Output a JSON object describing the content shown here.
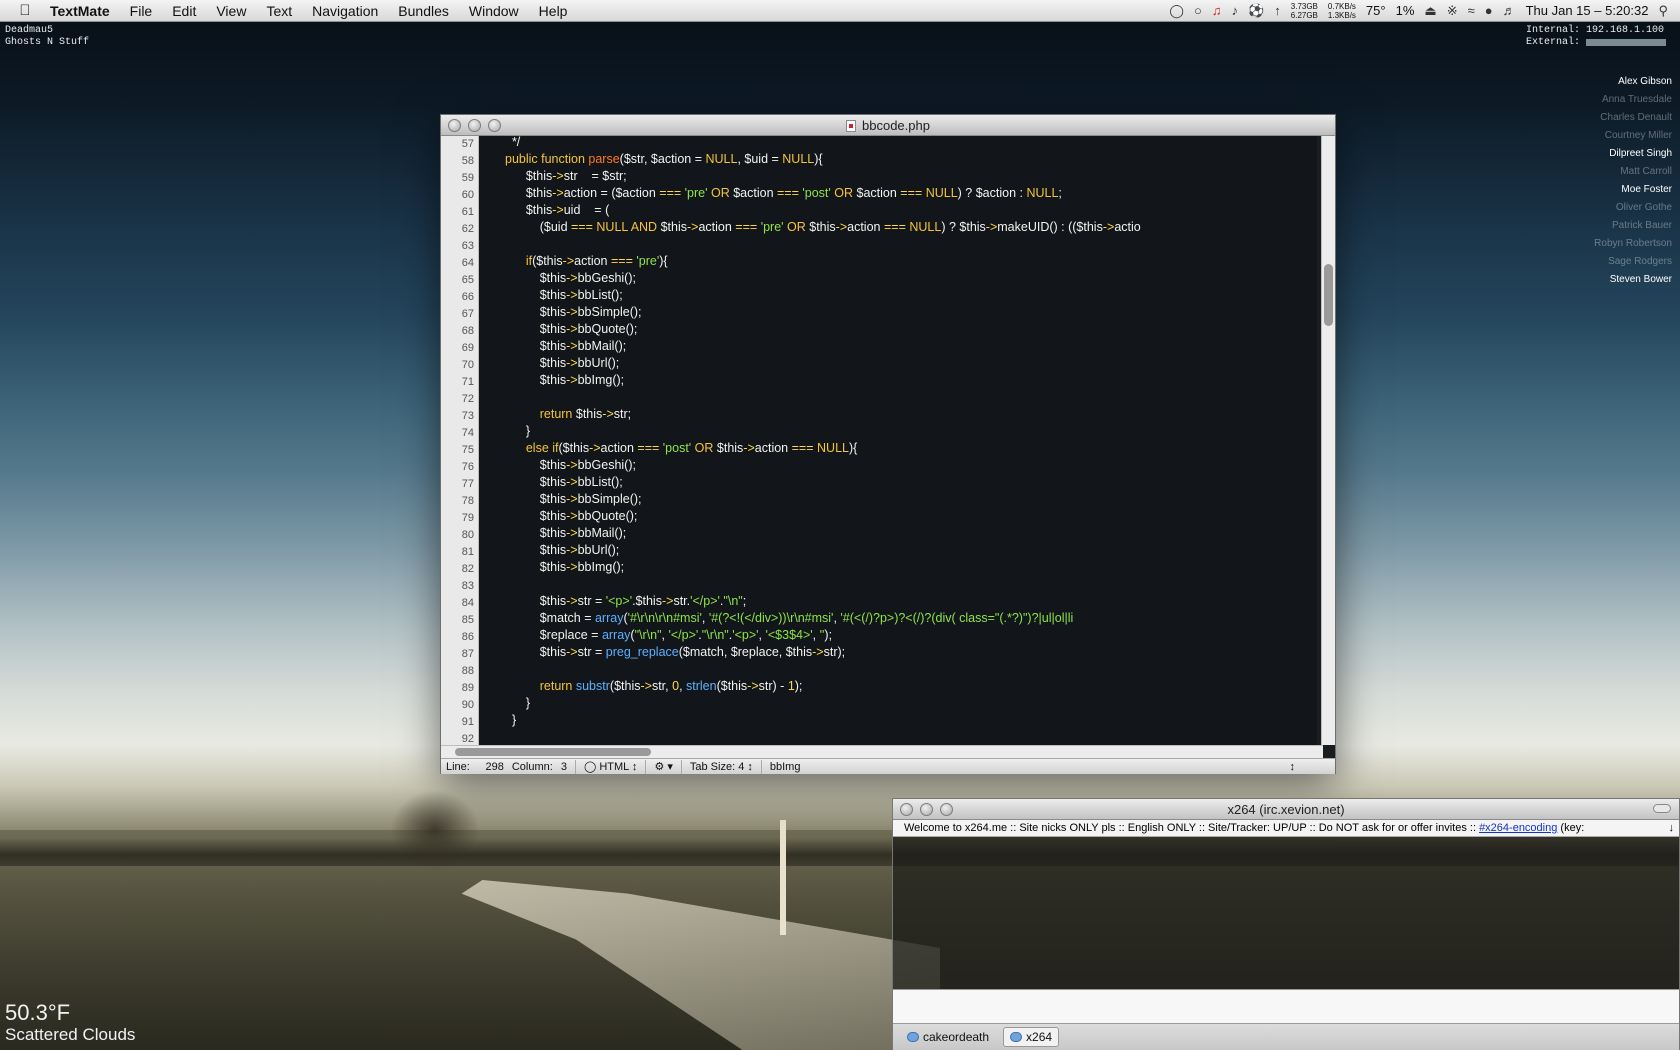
{
  "menubar": {
    "apple_icon": "apple-icon",
    "app_name": "TextMate",
    "menus": [
      "File",
      "Edit",
      "View",
      "Text",
      "Navigation",
      "Bundles",
      "Window",
      "Help"
    ],
    "disk": [
      "3.73GB",
      "6.27GB"
    ],
    "net": [
      "0.7KB/s",
      "1.3KB/s"
    ],
    "temperature": "75°",
    "cpu": "1%",
    "clock": "Thu Jan 15 – 5:20:32"
  },
  "desktop": {
    "now_playing": [
      "Deadmau5",
      "Ghosts N Stuff"
    ],
    "network": {
      "internal_label": "Internal:",
      "internal_value": "192.168.1.100",
      "external_label": "External:"
    },
    "buddies": [
      {
        "name": "Alex Gibson",
        "status": "online"
      },
      {
        "name": "Anna Truesdale",
        "status": "away"
      },
      {
        "name": "Charles Denault",
        "status": "away"
      },
      {
        "name": "Courtney Miller",
        "status": "away"
      },
      {
        "name": "Dilpreet Singh",
        "status": "online"
      },
      {
        "name": "Matt Carroll",
        "status": "away"
      },
      {
        "name": "Moe Foster",
        "status": "online"
      },
      {
        "name": "Oliver Gothe",
        "status": "away"
      },
      {
        "name": "Patrick Bauer",
        "status": "away"
      },
      {
        "name": "Robyn Robertson",
        "status": "away"
      },
      {
        "name": "Sage Rodgers",
        "status": "away"
      },
      {
        "name": "Steven Bower",
        "status": "online"
      }
    ],
    "weather": {
      "temp": "50.3°F",
      "condition": "Scattered Clouds"
    }
  },
  "textmate": {
    "title": "bbcode.php",
    "line_numbers": [
      "57",
      "58",
      "59",
      "60",
      "61",
      "62",
      "63",
      "64",
      "65",
      "66",
      "67",
      "68",
      "69",
      "70",
      "71",
      "72",
      "73",
      "74",
      "75",
      "76",
      "77",
      "78",
      "79",
      "80",
      "81",
      "82",
      "83",
      "84",
      "85",
      "86",
      "87",
      "88",
      "89",
      "90",
      "91",
      "92"
    ],
    "status": {
      "line_label": "Line:",
      "line_value": "298",
      "column_label": "Column:",
      "column_value": "3",
      "language": "HTML",
      "tab_size_label": "Tab Size:",
      "tab_size_value": "4",
      "symbol": "bbImg"
    }
  },
  "irc": {
    "title": "x264 (irc.xevion.net)",
    "topic_text": "Welcome to x264.me :: Site nicks ONLY pls :: English ONLY :: Site/Tracker: UP/UP :: Do NOT ask for or offer invites :: ",
    "topic_link": "#x264-encoding",
    "topic_tail": " (key:",
    "tabs": [
      "cakeordeath",
      "x264"
    ]
  }
}
